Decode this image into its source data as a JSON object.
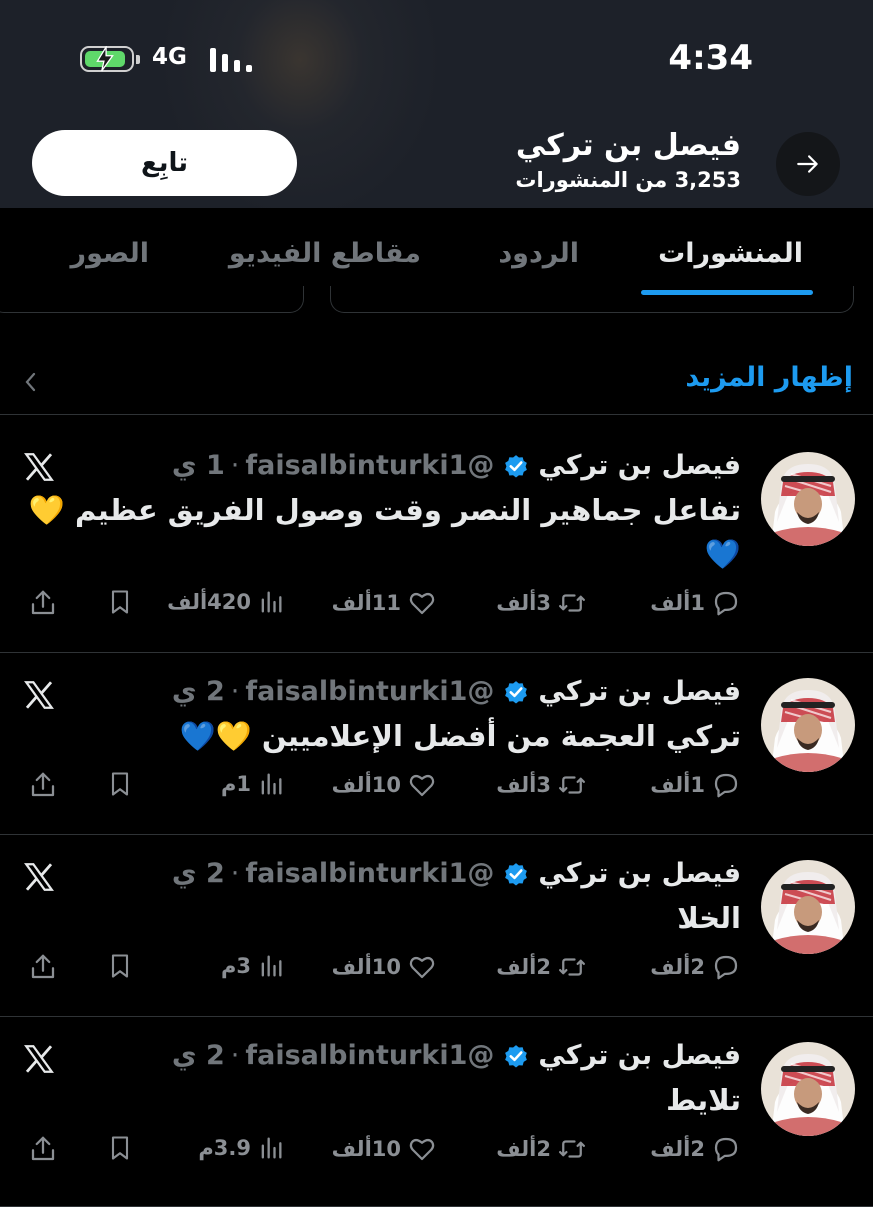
{
  "status_bar": {
    "network": "4G",
    "time": "4:34"
  },
  "profile": {
    "name": "فيصل بن تركي",
    "posts_count": "3,253 من المنشورات",
    "follow_label": "تابِع"
  },
  "tabs": [
    {
      "label": "المنشورات",
      "active": true
    },
    {
      "label": "الردود",
      "active": false
    },
    {
      "label": "مقاطع الفيديو",
      "active": false
    },
    {
      "label": "الصور",
      "active": false
    }
  ],
  "show_more": "إظهار المزيد",
  "colors": {
    "accent": "#1d9bf0",
    "background": "#000000",
    "muted": "#71767b"
  },
  "tweets": [
    {
      "name": "فيصل بن تركي",
      "handle": "@faisalbinturki1",
      "sep": "·",
      "age": "1 ي",
      "text": "تفاعل جماهير النصر وقت وصول الفريق عظيم 💛💙",
      "replies": "1ألف",
      "retweets": "3ألف",
      "likes": "11ألف",
      "views": "420ألف"
    },
    {
      "name": "فيصل بن تركي",
      "handle": "@faisalbinturki1",
      "sep": "·",
      "age": "2 ي",
      "text": "تركي العجمة من أفضل الإعلاميين 💛💙",
      "replies": "1ألف",
      "retweets": "3ألف",
      "likes": "10ألف",
      "views": "1م"
    },
    {
      "name": "فيصل بن تركي",
      "handle": "@faisalbinturki1",
      "sep": "·",
      "age": "2 ي",
      "text": "الخلا",
      "replies": "2ألف",
      "retweets": "2ألف",
      "likes": "10ألف",
      "views": "3م"
    },
    {
      "name": "فيصل بن تركي",
      "handle": "@faisalbinturki1",
      "sep": "·",
      "age": "2 ي",
      "text": "تلايط",
      "replies": "2ألف",
      "retweets": "2ألف",
      "likes": "10ألف",
      "views": "3.9م"
    }
  ]
}
